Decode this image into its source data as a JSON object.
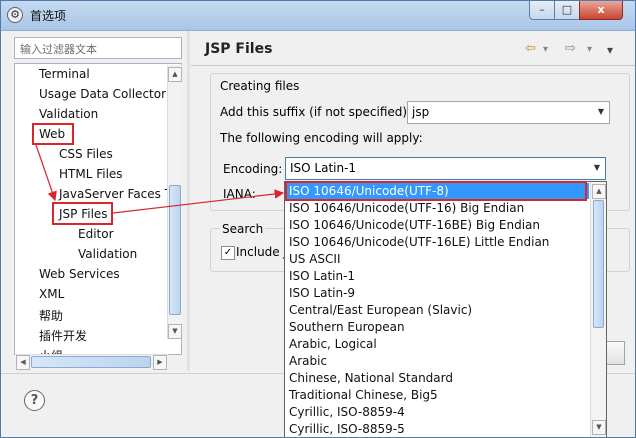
{
  "window": {
    "title": "首选项",
    "app_icon": "gear-icon",
    "min_glyph": "–",
    "max_glyph": "□",
    "close_glyph": "x"
  },
  "filter": {
    "placeholder": "输入过滤器文本"
  },
  "tree": [
    {
      "label": "Terminal"
    },
    {
      "label": "Usage Data Collector"
    },
    {
      "label": "Validation"
    },
    {
      "label": "Web"
    },
    {
      "label": "CSS Files"
    },
    {
      "label": "HTML Files"
    },
    {
      "label": "JavaServer Faces T"
    },
    {
      "label": "JSP Files"
    },
    {
      "label": "Editor"
    },
    {
      "label": "Validation"
    },
    {
      "label": "Web Services"
    },
    {
      "label": "XML"
    },
    {
      "label": "帮助"
    },
    {
      "label": "插件开发"
    },
    {
      "label": "小组"
    }
  ],
  "page": {
    "title": "JSP Files",
    "nav_back": "⇦",
    "nav_forward": "⇨",
    "nav_menu": "▾",
    "group_title": "Creating files",
    "suffix_label": "Add this suffix (if not specified):",
    "suffix_value": "jsp",
    "encoding_note": "The following encoding will apply:",
    "encoding_label": "Encoding:",
    "encoding_value": "ISO Latin-1",
    "iana_label": "IANA:",
    "search_label": "Search",
    "include_label": "Include J",
    "include_checked": "✓"
  },
  "dropdown": {
    "options": [
      "ISO 10646/Unicode(UTF-8)",
      "ISO 10646/Unicode(UTF-16) Big Endian",
      "ISO 10646/Unicode(UTF-16BE) Big Endian",
      "ISO 10646/Unicode(UTF-16LE) Little Endian",
      "US ASCII",
      "ISO Latin-1",
      "ISO Latin-9",
      "Central/East European (Slavic)",
      "Southern European",
      "Arabic, Logical",
      "Arabic",
      "Chinese, National Standard",
      "Traditional Chinese, Big5",
      "Cyrillic, ISO-8859-4",
      "Cyrillic, ISO-8859-5"
    ],
    "selected": "ISO 10646/Unicode(UTF-8)"
  },
  "help": {
    "glyph": "?"
  },
  "colors": {
    "annotation": "#d9262b",
    "selection": "#3399ff"
  }
}
